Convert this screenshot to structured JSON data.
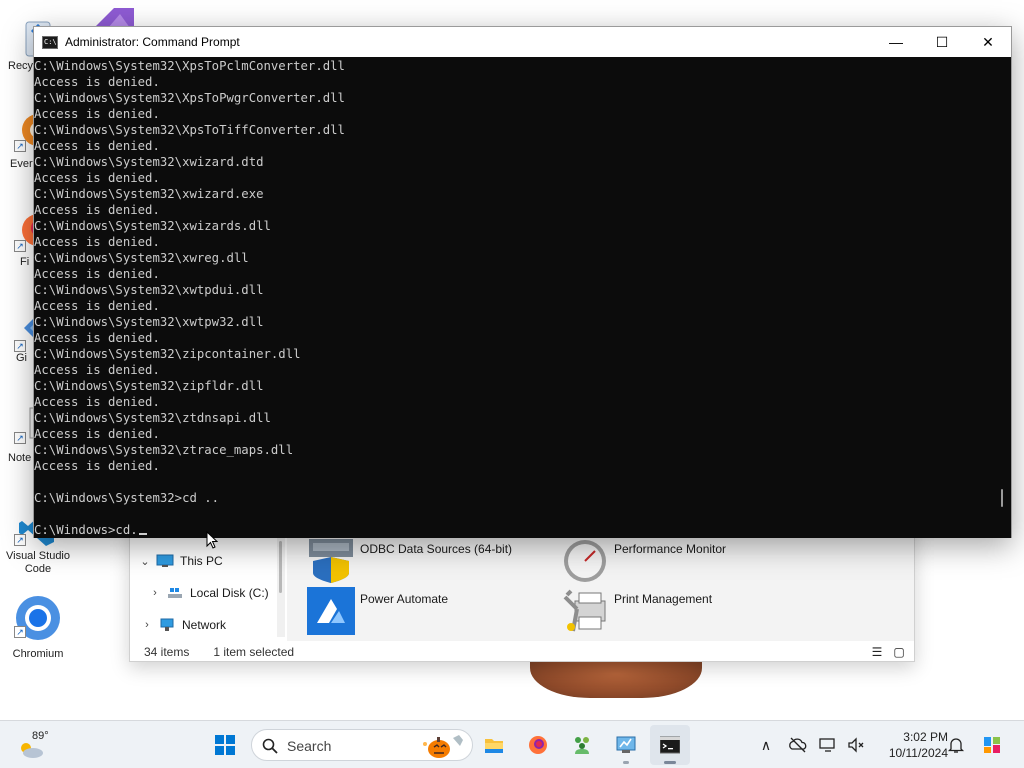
{
  "desktop": {
    "icons": [
      {
        "label": "Recy"
      },
      {
        "label": "Ever"
      },
      {
        "label": "Fi"
      },
      {
        "label": "Gi"
      },
      {
        "label": "Note"
      },
      {
        "label": "Visual Studio Code"
      },
      {
        "label": "Chromium"
      }
    ]
  },
  "cmd": {
    "title": "Administrator: Command Prompt",
    "icon_text": "C:\\",
    "controls": {
      "minimize": "—",
      "maximize": "☐",
      "close": "✕"
    },
    "lines": [
      "C:\\Windows\\System32\\XpsToPclmConverter.dll",
      "Access is denied.",
      "C:\\Windows\\System32\\XpsToPwgrConverter.dll",
      "Access is denied.",
      "C:\\Windows\\System32\\XpsToTiffConverter.dll",
      "Access is denied.",
      "C:\\Windows\\System32\\xwizard.dtd",
      "Access is denied.",
      "C:\\Windows\\System32\\xwizard.exe",
      "Access is denied.",
      "C:\\Windows\\System32\\xwizards.dll",
      "Access is denied.",
      "C:\\Windows\\System32\\xwreg.dll",
      "Access is denied.",
      "C:\\Windows\\System32\\xwtpdui.dll",
      "Access is denied.",
      "C:\\Windows\\System32\\xwtpw32.dll",
      "Access is denied.",
      "C:\\Windows\\System32\\zipcontainer.dll",
      "Access is denied.",
      "C:\\Windows\\System32\\zipfldr.dll",
      "Access is denied.",
      "C:\\Windows\\System32\\ztdnsapi.dll",
      "Access is denied.",
      "C:\\Windows\\System32\\ztrace_maps.dll",
      "Access is denied.",
      "",
      "C:\\Windows\\System32>cd ..",
      ""
    ],
    "current_input": "C:\\Windows>cd."
  },
  "explorer": {
    "nav": [
      {
        "label": "This PC",
        "chevron": "⌄",
        "icon": "monitor-icon"
      },
      {
        "label": "Local Disk (C:)",
        "chevron": "›",
        "icon": "drive-icon"
      },
      {
        "label": "Network",
        "chevron": "›",
        "icon": "network-icon"
      }
    ],
    "items": [
      {
        "label": "ODBC Data Sources (64-bit)",
        "icon": "odbc-icon"
      },
      {
        "label": "Performance Monitor",
        "icon": "performance-monitor-icon"
      },
      {
        "label": "Power Automate",
        "icon": "power-automate-icon"
      },
      {
        "label": "Print Management",
        "icon": "print-management-icon"
      }
    ],
    "status": {
      "count": "34 items",
      "selected": "1 item selected"
    },
    "view_buttons": {
      "details": "☰",
      "tiles": "▢"
    }
  },
  "taskbar": {
    "weather_temp": "89°",
    "search_placeholder": "Search",
    "apps": [
      {
        "name": "start",
        "icon": "windows-start-icon"
      },
      {
        "name": "file-explorer",
        "icon": "folder-icon"
      },
      {
        "name": "firefox",
        "icon": "firefox-icon"
      },
      {
        "name": "settings-people",
        "icon": "people-icon"
      },
      {
        "name": "control-panel",
        "icon": "control-panel-icon"
      },
      {
        "name": "command-prompt",
        "icon": "terminal-icon",
        "active": true
      }
    ],
    "tray": {
      "chevron": "∧",
      "time": "3:02 PM",
      "date": "10/11/2024"
    }
  },
  "colors": {
    "console_bg": "#0c0c0c",
    "console_text": "#cccccc",
    "taskbar_bg": "#eef2f6",
    "accent_blue": "#0078d4"
  }
}
